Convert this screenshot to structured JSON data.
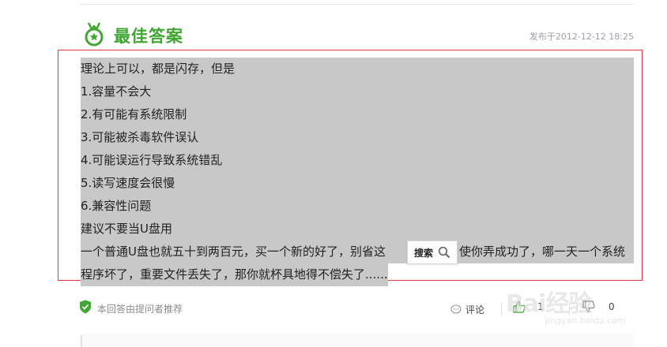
{
  "header": {
    "title": "最佳答案",
    "post_time": "发布于2012-12-12 18:25",
    "accent_color": "#40a832"
  },
  "answer": {
    "lines": [
      "理论上可以，都是闪存，但是",
      "1.容量不会大",
      "2.有可能有系统限制",
      "3.可能被杀毒软件误认",
      "4.可能误运行导致系统错乱",
      "5.读写速度会很慢",
      "6.兼容性问题",
      "建议不要当U盘用",
      "一个普通U盘也就五十到两百元，买一个新的好了，别省这",
      "使你弄成功了，哪一天一个系统",
      "程序坏了，重要文件丢失了，那你就杯具地得不偿失了......"
    ],
    "highlight_color": "#c8c8c8",
    "box_border_color": "#e0333b"
  },
  "search_popup": {
    "label": "搜索",
    "icon": "magnifier-icon"
  },
  "footer": {
    "recommend_text": "本回答由提问者推荐",
    "comment_label": "评论",
    "like_count": "1",
    "dislike_count": "0"
  },
  "watermark": {
    "logo_text": "Bai经验",
    "url_text": "jingyan.baidu.com"
  }
}
